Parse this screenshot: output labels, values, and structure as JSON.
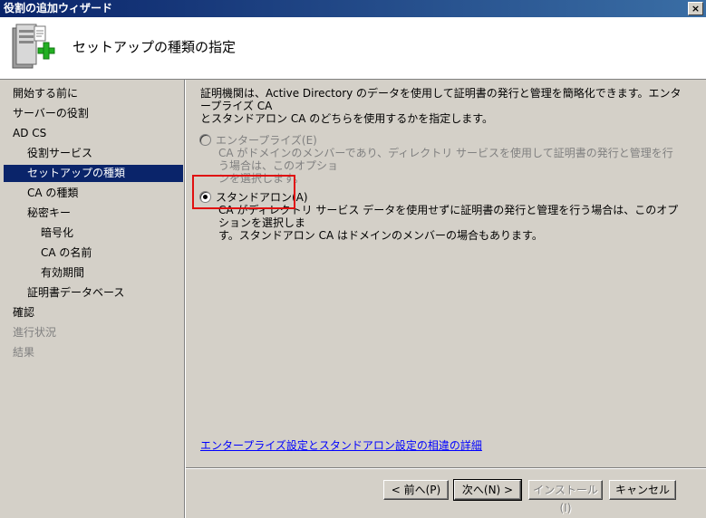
{
  "window": {
    "title": "役割の追加ウィザード",
    "close_glyph": "×"
  },
  "header": {
    "title": "セットアップの種類の指定"
  },
  "sidebar": {
    "items": [
      {
        "label": "開始する前に",
        "level": 0,
        "state": "normal"
      },
      {
        "label": "サーバーの役割",
        "level": 0,
        "state": "normal"
      },
      {
        "label": "AD CS",
        "level": 0,
        "state": "normal"
      },
      {
        "label": "役割サービス",
        "level": 1,
        "state": "normal"
      },
      {
        "label": "セットアップの種類",
        "level": 1,
        "state": "selected"
      },
      {
        "label": "CA の種類",
        "level": 1,
        "state": "normal"
      },
      {
        "label": "秘密キー",
        "level": 1,
        "state": "normal"
      },
      {
        "label": "暗号化",
        "level": 2,
        "state": "normal"
      },
      {
        "label": "CA の名前",
        "level": 2,
        "state": "normal"
      },
      {
        "label": "有効期間",
        "level": 2,
        "state": "normal"
      },
      {
        "label": "証明書データベース",
        "level": 1,
        "state": "normal"
      },
      {
        "label": "確認",
        "level": 0,
        "state": "normal"
      },
      {
        "label": "進行状況",
        "level": 0,
        "state": "disabled"
      },
      {
        "label": "結果",
        "level": 0,
        "state": "disabled"
      }
    ]
  },
  "main": {
    "description_line1": "証明機関は、Active Directory のデータを使用して証明書の発行と管理を簡略化できます。エンタープライズ CA",
    "description_line2": "とスタンドアロン CA のどちらを使用するかを指定します。",
    "enterprise": {
      "label": "エンタープライズ(E)",
      "desc_line1": "CA がドメインのメンバーであり、ディレクトリ サービスを使用して証明書の発行と管理を行う場合は、このオプショ",
      "desc_line2": "ンを選択します。",
      "enabled": false,
      "checked": false
    },
    "standalone": {
      "label": "スタンドアロン(A)",
      "desc_line1": "CA がディレクトリ サービス データを使用せずに証明書の発行と管理を行う場合は、このオプションを選択しま",
      "desc_line2": "す。スタンドアロン CA はドメインのメンバーの場合もあります。",
      "enabled": true,
      "checked": true
    },
    "details_link": "エンタープライズ設定とスタンドアロン設定の相違の詳細"
  },
  "buttons": {
    "prev": "< 前へ(P)",
    "next": "次へ(N) >",
    "install": "インストール(I)",
    "cancel": "キャンセル"
  },
  "colors": {
    "selection": "#0a246a",
    "highlight_box": "#e01010",
    "link": "#0000ff",
    "disabled_text": "#808080"
  }
}
